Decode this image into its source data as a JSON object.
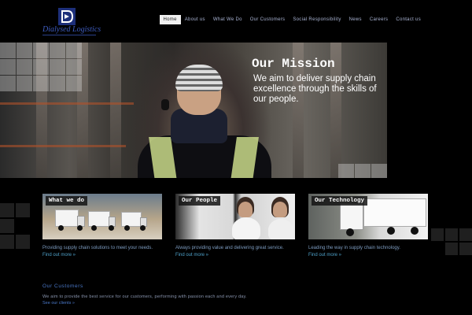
{
  "brand": {
    "logo_text": "Dialysed Logistics"
  },
  "nav": {
    "items": [
      {
        "label": "Home",
        "active": true
      },
      {
        "label": "About us",
        "active": false
      },
      {
        "label": "What We Do",
        "active": false
      },
      {
        "label": "Our Customers",
        "active": false
      },
      {
        "label": "Social Responsibility",
        "active": false
      },
      {
        "label": "News",
        "active": false
      },
      {
        "label": "Careers",
        "active": false
      },
      {
        "label": "Contact us",
        "active": false
      }
    ]
  },
  "banner": {
    "title": "Our Mission",
    "text": "We aim to deliver supply chain excellence through the skills of our people."
  },
  "cards": [
    {
      "title": "What we do",
      "desc": "Providing supply chain solutions to meet your needs.",
      "link": "Find out more »"
    },
    {
      "title": "Our People",
      "desc": "Always providing value and delivering great service.",
      "link": "Find out more »"
    },
    {
      "title": "Our Technology",
      "desc": "Leading the way in supply chain technology.",
      "link": "Find out more »"
    }
  ],
  "customers": {
    "title": "Our Customers",
    "text": "We aim to provide the best service for our customers, performing with passion each and every day.",
    "link": "See our clients »"
  },
  "colors": {
    "accent": "#4a78c8",
    "brand": "#2a3f8a",
    "vest": "#c9d98a"
  }
}
